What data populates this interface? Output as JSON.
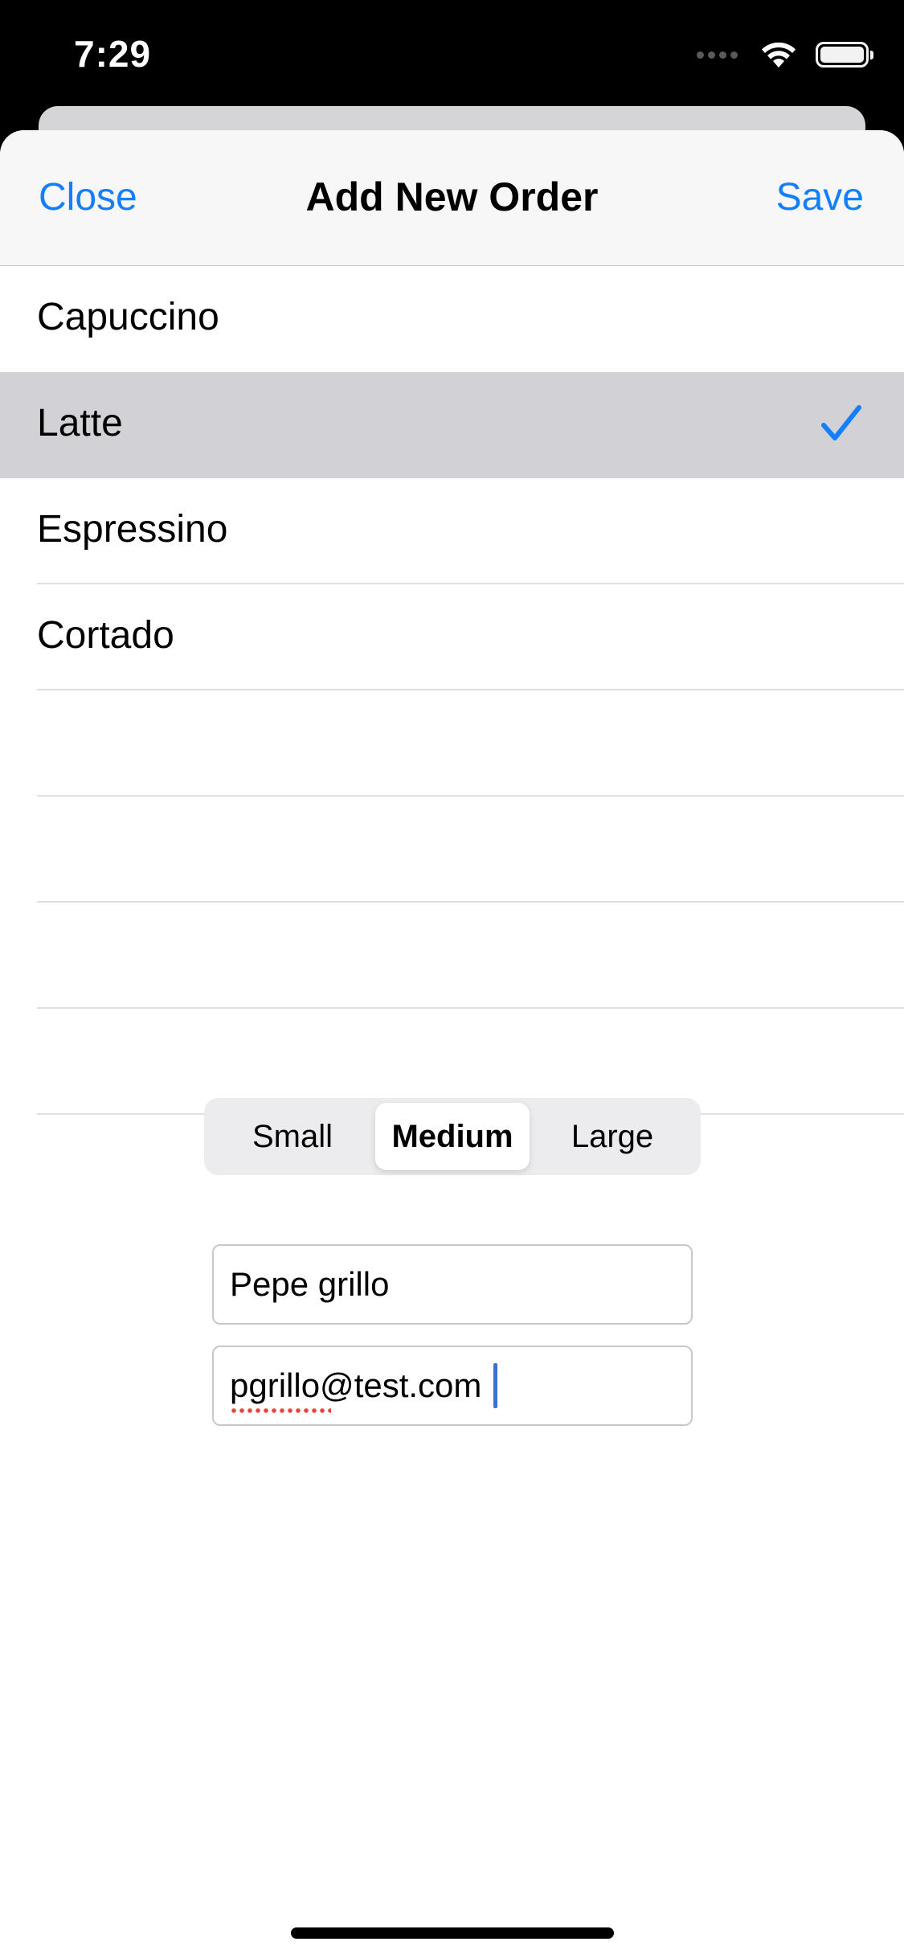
{
  "status_bar": {
    "time": "7:29"
  },
  "nav": {
    "close_label": "Close",
    "title": "Add New Order",
    "save_label": "Save"
  },
  "coffee_list": {
    "items": [
      {
        "label": "Capuccino",
        "selected": false
      },
      {
        "label": "Latte",
        "selected": true
      },
      {
        "label": "Espressino",
        "selected": false
      },
      {
        "label": "Cortado",
        "selected": false
      }
    ],
    "empty_rows": 4
  },
  "size_control": {
    "options": [
      "Small",
      "Medium",
      "Large"
    ],
    "selected": "Medium"
  },
  "form": {
    "name_value": "Pepe grillo",
    "email_value": "pgrillo@test.com"
  },
  "colors": {
    "accent": "#157efb",
    "selected_row": "#d1d1d6",
    "spellcheck": "#e24a3b"
  },
  "icons": {
    "check": "checkmark-icon",
    "wifi": "wifi-icon",
    "battery": "battery-icon",
    "signal": "signal-icon"
  }
}
